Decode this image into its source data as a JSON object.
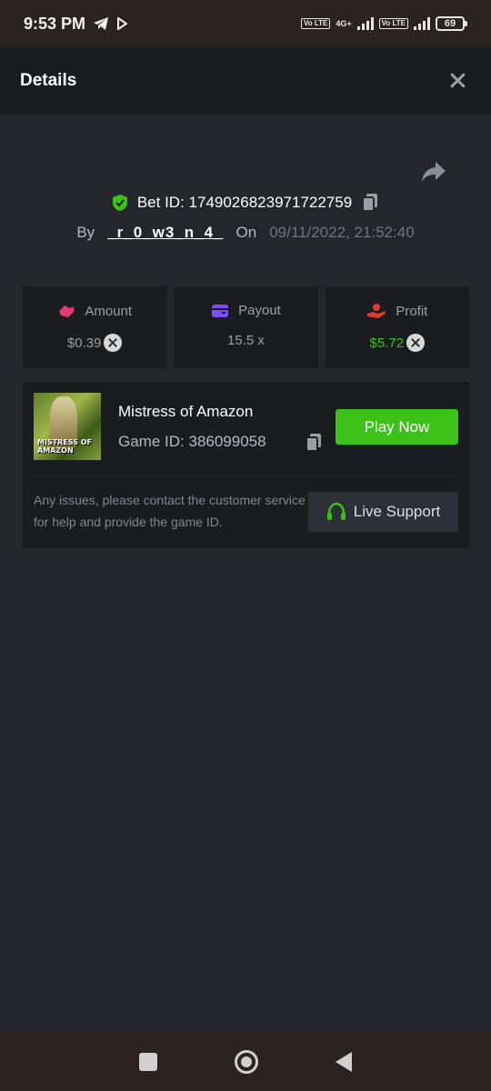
{
  "status_bar": {
    "time": "9:53 PM",
    "network_label": "4G+",
    "volte_label": "Vo LTE",
    "battery": "69"
  },
  "header": {
    "title": "Details"
  },
  "bet": {
    "id_label": "Bet ID:",
    "id_value": "1749026823971722759",
    "by_label": "By",
    "user": "_r_0_w3_n_4_",
    "on_label": "On",
    "datetime": "09/11/2022, 21:52:40"
  },
  "stats": {
    "amount_label": "Amount",
    "amount_value": "$0.39",
    "payout_label": "Payout",
    "payout_value": "15.5 x",
    "profit_label": "Profit",
    "profit_value": "$5.72"
  },
  "game": {
    "name": "Mistress of Amazon",
    "id_label": "Game ID:",
    "id_value": "386099058",
    "thumb_text": "MISTRESS OF AMAZON",
    "play_label": "Play Now",
    "note": "Any issues, please contact the customer service for help and provide the game ID.",
    "support_label": "Live Support"
  },
  "colors": {
    "accent_green": "#3bc117",
    "background": "#24262b",
    "card": "#1b1c20",
    "amount_icon": "#e23c6e",
    "payout_icon": "#7c4dff",
    "profit_icon": "#e53935"
  }
}
